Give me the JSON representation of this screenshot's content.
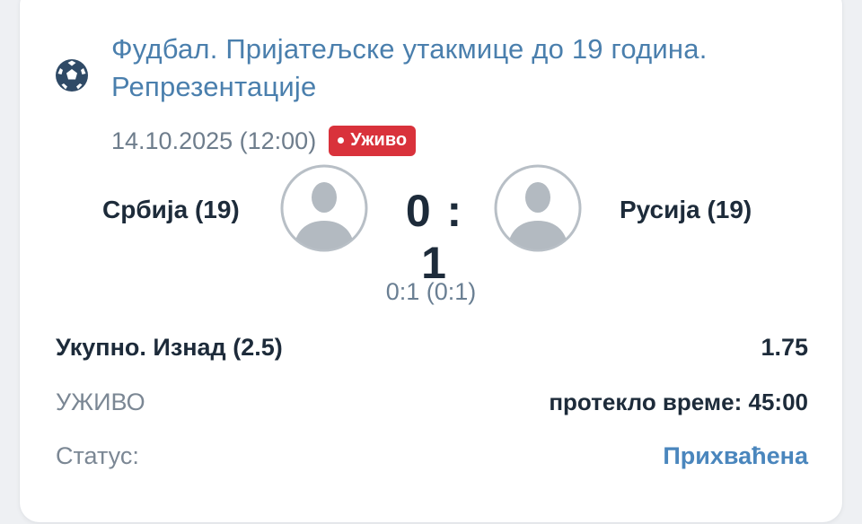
{
  "event": {
    "title": "Фудбал. Пријатељске утакмице до 19 година. Репрезентације",
    "datetime": "14.10.2025 (12:00)",
    "live_badge": "Уживо",
    "sport_icon": "football-icon"
  },
  "match": {
    "home_team": "Србија (19)",
    "away_team": "Русија (19)",
    "score": "0 : 1",
    "subscore": "0:1 (0:1)"
  },
  "bet": {
    "name": "Укупно. Изнад (2.5)",
    "odds": "1.75"
  },
  "live": {
    "label": "УЖИВО",
    "elapsed": "протекло време: 45:00"
  },
  "status": {
    "label": "Статус:",
    "value": "Прихваћена"
  },
  "colors": {
    "accent": "#4a7fad",
    "live_badge": "#d9323b",
    "status_accepted": "#4a86bd",
    "text_dark": "#1d2b3a"
  }
}
